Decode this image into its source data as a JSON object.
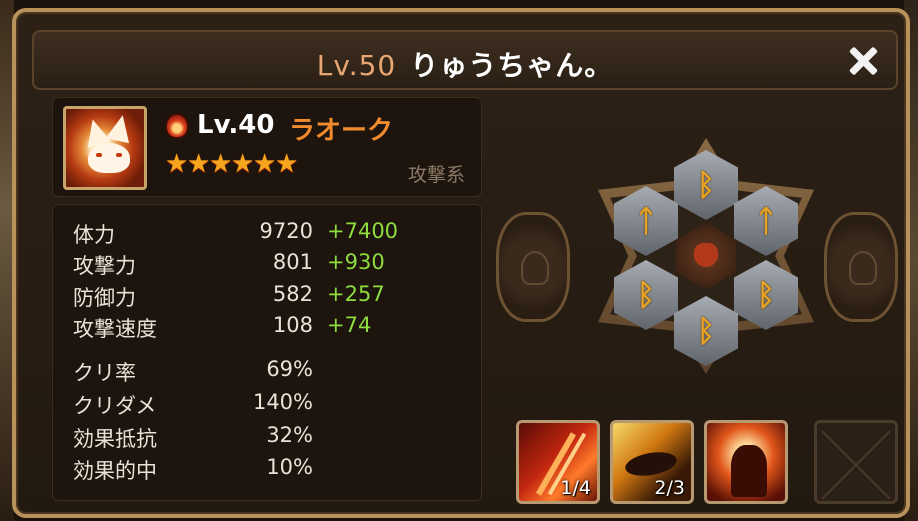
{
  "header": {
    "level": "Lv.50",
    "player_name": "りゅうちゃん。"
  },
  "monster": {
    "level": "Lv.40",
    "name": "ラオーク",
    "element_icon": "fire-element-icon",
    "stars": 6,
    "type": "攻撃系"
  },
  "stats": {
    "main": [
      {
        "label": "体力",
        "value": "9720",
        "bonus": "+7400"
      },
      {
        "label": "攻撃力",
        "value": "801",
        "bonus": "+930"
      },
      {
        "label": "防御力",
        "value": "582",
        "bonus": "+257"
      },
      {
        "label": "攻撃速度",
        "value": "108",
        "bonus": "+74"
      }
    ],
    "secondary": [
      {
        "label": "クリ率",
        "value": "69%"
      },
      {
        "label": "クリダメ",
        "value": "140%"
      },
      {
        "label": "効果抵抗",
        "value": "32%"
      },
      {
        "label": "効果的中",
        "value": "10%"
      }
    ]
  },
  "runes": {
    "top": "ᛒ",
    "upper_left": "ᛏ",
    "upper_right": "ᛏ",
    "lower_left": "ᛒ",
    "lower_right": "ᛒ",
    "bottom": "ᛒ"
  },
  "skills": [
    {
      "icon": "claw-slash-skill-icon",
      "level": "1/4"
    },
    {
      "icon": "fire-dragon-skill-icon",
      "level": "2/3"
    },
    {
      "icon": "howling-wolf-skill-icon",
      "level": ""
    }
  ],
  "colors": {
    "frame": "#b8925a",
    "bonus_green": "#8fdc3e",
    "name_orange": "#f28a2e",
    "rune_gold": "#e9a424"
  }
}
